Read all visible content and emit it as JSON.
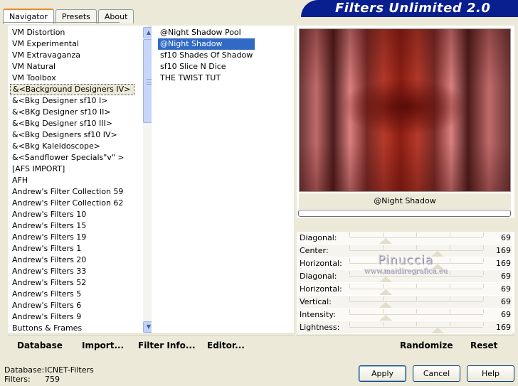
{
  "tabs": [
    {
      "label": "Navigator",
      "active": true
    },
    {
      "label": "Presets",
      "active": false
    },
    {
      "label": "About",
      "active": false
    }
  ],
  "banner_title": "Filters Unlimited 2.0",
  "categories": [
    "VM Distortion",
    "VM Experimental",
    "VM Extravaganza",
    "VM Natural",
    "VM Toolbox",
    "&<Background Designers IV>",
    "&<Bkg Designer sf10 I>",
    "&<BKg Designer sf10 II>",
    "&<Bkg Designer sf10 III>",
    "&<Bkg Designers sf10 IV>",
    "&<Bkg Kaleidoscope>",
    "&<Sandflower Specials\"v\" >",
    "[AFS IMPORT]",
    "AFH",
    "Andrew's Filter Collection 59",
    "Andrew's Filter Collection 62",
    "Andrew's Filters 10",
    "Andrew's Filters 15",
    "Andrew's Filters 19",
    "Andrew's Filters 1",
    "Andrew's Filters 20",
    "Andrew's Filters 33",
    "Andrew's Filters 52",
    "Andrew's Filters 5",
    "Andrew's Filters 6",
    "Andrew's Filters 9",
    "Buttons & Frames"
  ],
  "selected_category_index": 5,
  "filters": [
    "@Night Shadow Pool",
    "@Night Shadow",
    "sf10 Shades Of Shadow",
    "sf10 Slice N Dice",
    "THE TWIST TUT"
  ],
  "selected_filter_index": 1,
  "preview": {
    "filter_name": "@Night Shadow"
  },
  "params": [
    {
      "label": "Diagonal:",
      "value": "69",
      "level": 0.27
    },
    {
      "label": "Center:",
      "value": "169",
      "level": 0.66
    },
    {
      "label": "Horizontal:",
      "value": "169",
      "level": 0.66
    },
    {
      "label": "Diagonal:",
      "value": "69",
      "level": 0.27
    },
    {
      "label": "Horizontal:",
      "value": "69",
      "level": 0.27
    },
    {
      "label": "Vertical:",
      "value": "69",
      "level": 0.27
    },
    {
      "label": "Intensity:",
      "value": "69",
      "level": 0.27
    },
    {
      "label": "Lightness:",
      "value": "169",
      "level": 0.66
    }
  ],
  "watermark": {
    "line1": "Pinuccia",
    "line2": "www.maidiregrafica.eu"
  },
  "toolbar": {
    "database": "Database",
    "import": "Import...",
    "filter_info": "Filter Info...",
    "editor": "Editor...",
    "randomize": "Randomize",
    "reset": "Reset"
  },
  "status": {
    "database_label": "Database:",
    "database_value": "ICNET-Filters",
    "filters_label": "Filters:",
    "filters_value": "759"
  },
  "buttons": {
    "apply": "Apply",
    "cancel": "Cancel",
    "help": "Help"
  }
}
